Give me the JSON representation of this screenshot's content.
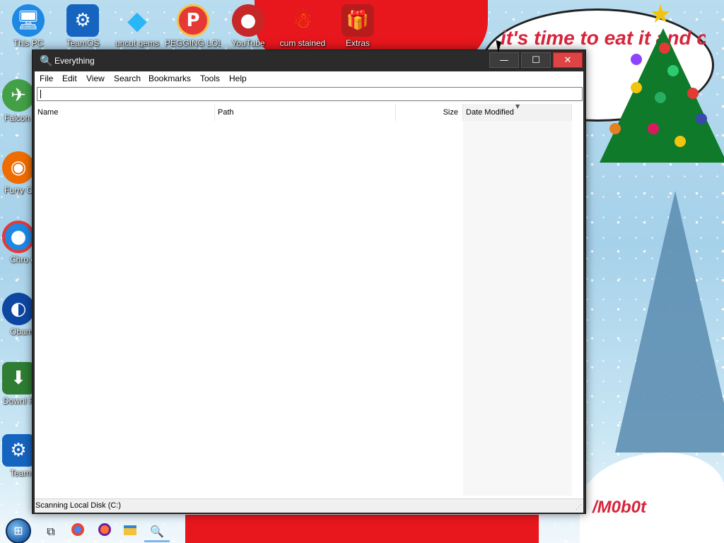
{
  "wallpaper": {
    "bubble_text": "it's time to eat it and can",
    "signature": "/M0b0t"
  },
  "desktop_icons": {
    "top_row": [
      {
        "label": "This PC",
        "icon": "monitor-icon",
        "color": "#1e88e5"
      },
      {
        "label": "TeamOS",
        "icon": "gear-icon",
        "color": "#1565c0"
      },
      {
        "label": "uncut gems",
        "icon": "gem-icon",
        "color": "#29b6f6"
      },
      {
        "label": "PEGGING LOL",
        "icon": "peggle-p-icon",
        "color": "#e53935"
      },
      {
        "label": "YouTube",
        "icon": "angry-bird-icon",
        "color": "#c62828"
      },
      {
        "label": "cum stained",
        "icon": "snowman-icon",
        "color": "#ef6c00"
      },
      {
        "label": "Extras",
        "icon": "gift-box-icon",
        "color": "#b71c1c"
      }
    ],
    "left_column": [
      {
        "label": "Falcon",
        "icon": "falcon-icon",
        "color": "#43a047"
      },
      {
        "label": "Furry C",
        "icon": "firefox-icon",
        "color": "#ef6c00"
      },
      {
        "label": "Chro dise",
        "icon": "chrome-icon",
        "color": "#1e88e5"
      },
      {
        "label": "Obam Brow",
        "icon": "obama-logo-icon",
        "color": "#0d47a1"
      },
      {
        "label": "Downl From te",
        "icon": "download-icon",
        "color": "#2e7d32"
      },
      {
        "label": "Team Faceb",
        "icon": "gear-icon",
        "color": "#1565c0"
      }
    ]
  },
  "window": {
    "title": "Everything",
    "buttons": {
      "minimize": "—",
      "maximize": "☐",
      "close": "✕"
    },
    "menu": [
      "File",
      "Edit",
      "View",
      "Search",
      "Bookmarks",
      "Tools",
      "Help"
    ],
    "search": {
      "value": "",
      "placeholder": ""
    },
    "columns": [
      "Name",
      "Path",
      "Size",
      "Date Modified"
    ],
    "sorted_column": "Date Modified",
    "rows": [],
    "status": "Scanning Local Disk (C:)"
  },
  "taskbar": {
    "items": [
      "start-orb",
      "task-view",
      "chrome",
      "firefox",
      "file-explorer",
      "everything"
    ],
    "active": "everything"
  },
  "colors": {
    "titlebar": "#2b2b2b",
    "close_button": "#e04343",
    "accent_orange": "#f39a1e"
  }
}
